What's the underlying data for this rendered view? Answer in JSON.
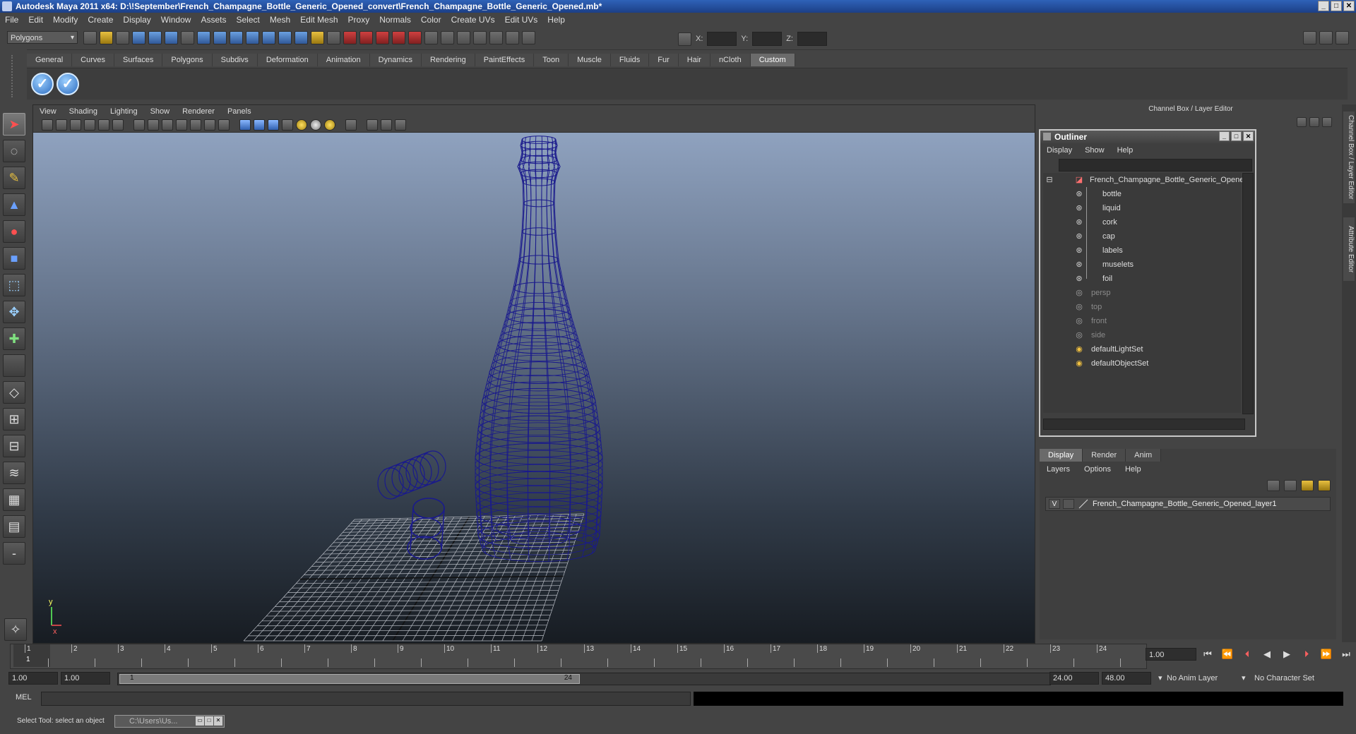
{
  "window": {
    "title": "Autodesk Maya 2011 x64: D:\\!September\\French_Champagne_Bottle_Generic_Opened_convert\\French_Champagne_Bottle_Generic_Opened.mb*",
    "min": "_",
    "max": "□",
    "close": "✕"
  },
  "menubar": [
    "File",
    "Edit",
    "Modify",
    "Create",
    "Display",
    "Window",
    "Assets",
    "Select",
    "Mesh",
    "Edit Mesh",
    "Proxy",
    "Normals",
    "Color",
    "Create UVs",
    "Edit UVs",
    "Help"
  ],
  "toolbar": {
    "mode": "Polygons",
    "x_label": "X:",
    "y_label": "Y:",
    "z_label": "Z:"
  },
  "shelf": {
    "tabs": [
      "General",
      "Curves",
      "Surfaces",
      "Polygons",
      "Subdivs",
      "Deformation",
      "Animation",
      "Dynamics",
      "Rendering",
      "PaintEffects",
      "Toon",
      "Muscle",
      "Fluids",
      "Fur",
      "Hair",
      "nCloth",
      "Custom"
    ],
    "active_tab": "Custom"
  },
  "viewport": {
    "menu": [
      "View",
      "Shading",
      "Lighting",
      "Show",
      "Renderer",
      "Panels"
    ],
    "wire_color": "#1a1a8c",
    "axis_y": "y",
    "axis_x": "x"
  },
  "channelbox_header": "Channel Box / Layer Editor",
  "outliner": {
    "title": "Outliner",
    "menu": [
      "Display",
      "Show",
      "Help"
    ],
    "root": "French_Champagne_Bottle_Generic_Opene",
    "children": [
      "bottle",
      "liquid",
      "cork",
      "cap",
      "labels",
      "muselets",
      "foil"
    ],
    "cameras": [
      "persp",
      "top",
      "front",
      "side"
    ],
    "sets": [
      "defaultLightSet",
      "defaultObjectSet"
    ]
  },
  "layer_editor": {
    "tabs": [
      "Display",
      "Render",
      "Anim"
    ],
    "active_tab": "Display",
    "menu": [
      "Layers",
      "Options",
      "Help"
    ],
    "layer_name": "French_Champagne_Bottle_Generic_Opened_layer1",
    "visible": "V"
  },
  "side_tabs": [
    "Channel Box / Layer Editor",
    "Attribute Editor"
  ],
  "timeslider": {
    "ticks": [
      "1",
      "2",
      "3",
      "4",
      "5",
      "6",
      "7",
      "8",
      "9",
      "10",
      "11",
      "12",
      "13",
      "14",
      "15",
      "16",
      "17",
      "18",
      "19",
      "20",
      "21",
      "22",
      "23",
      "24"
    ],
    "current_frame": "1",
    "current_value": "1.00"
  },
  "range": {
    "start": "1.00",
    "inner_start": "1.00",
    "thumb_start": "1",
    "thumb_end": "24",
    "end": "24.00",
    "outer_end": "48.00",
    "anim_layer": "No Anim Layer",
    "char_set": "No Character Set"
  },
  "cmdline": {
    "label": "MEL"
  },
  "helpline": {
    "text": "Select Tool: select an object",
    "task": "C:\\Users\\Us..."
  }
}
